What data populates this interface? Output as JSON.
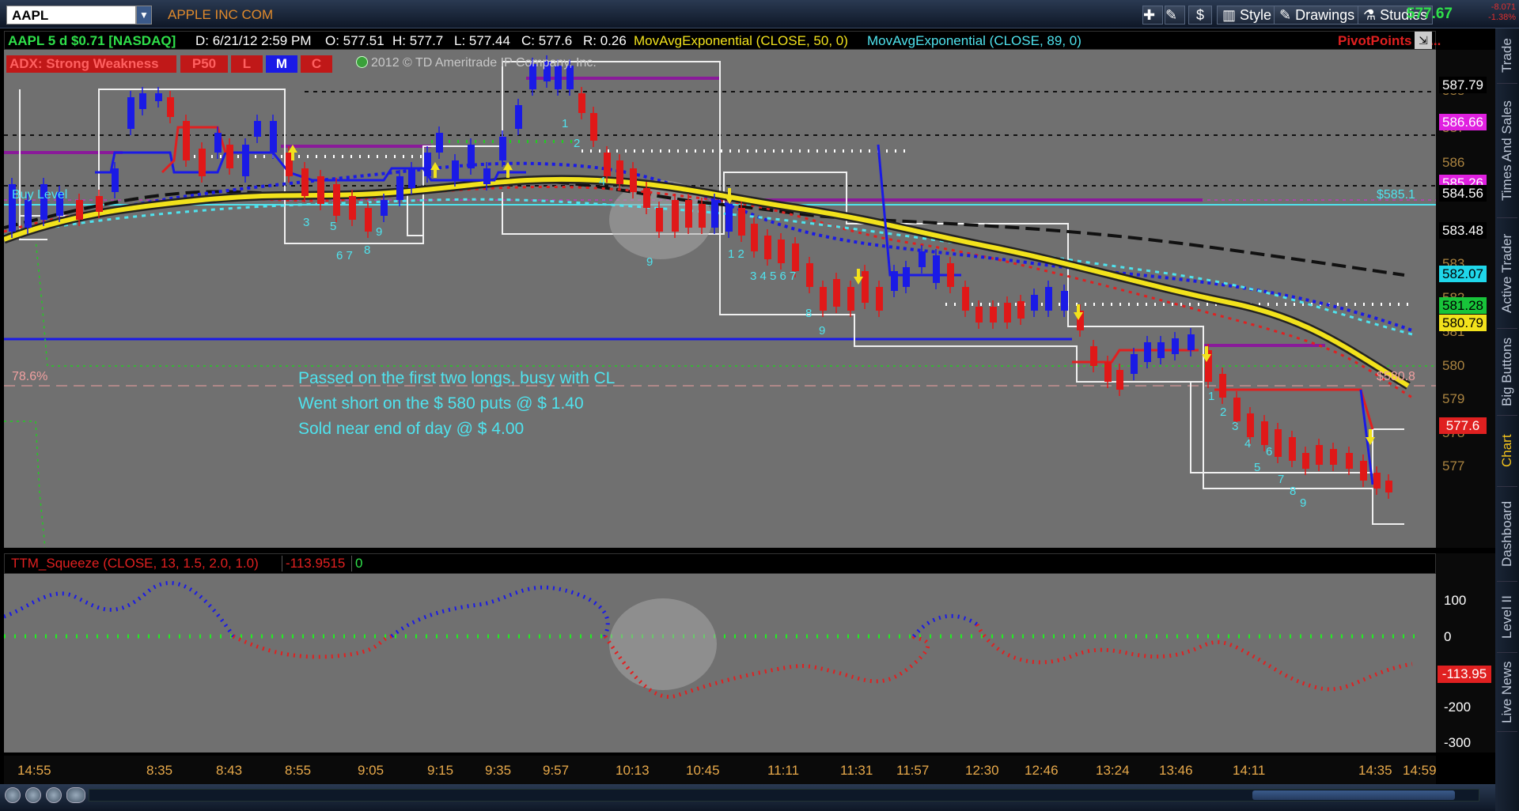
{
  "toolbar": {
    "symbol": "AAPL",
    "company": "APPLE INC COM",
    "dollar_label": "$",
    "style_label": "Style",
    "drawings_label": "Drawings",
    "studies_label": "Studies",
    "last_price": "577.67",
    "change_abs": "-8.071",
    "change_pct": "-1.38%"
  },
  "info": {
    "symbol_desc": "AAPL 5 d $0.71 [NASDAQ]",
    "date": "D: 6/21/12 2:59 PM",
    "open": "O: 577.51",
    "high": "H: 577.7",
    "low": "L: 577.44",
    "close": "C: 577.6",
    "range": "R: 0.26",
    "ema50": "MovAvgExponential (CLOSE, 50, 0)",
    "ema89": "MovAvgExponential (CLOSE, 89, 0)",
    "pivot": "PivotPoints (N..."
  },
  "indicators": {
    "adx": "ADX: Strong Weakness",
    "p50": "P50",
    "l": "L",
    "m": "M",
    "c": "C",
    "copyright": "2012 © TD Ameritrade IP Company, Inc."
  },
  "right_tabs": [
    "Trade",
    "Times And Sales",
    "Active Trader",
    "Big Buttons",
    "Chart",
    "Dashboard",
    "Level II",
    "Live News"
  ],
  "price_labels": [
    {
      "text": "587.79",
      "bg": "#000000",
      "fg": "#ffffff"
    },
    {
      "text": "586.66",
      "bg": "#e020e0",
      "fg": "#ffffff"
    },
    {
      "text": "585.26",
      "bg": "#e020e0",
      "fg": "#ffffff"
    },
    {
      "text": "584.56",
      "bg": "#000000",
      "fg": "#ffffff"
    },
    {
      "text": "583.48",
      "bg": "#000000",
      "fg": "#ffffff"
    },
    {
      "text": "582.07",
      "bg": "#1fd7ea",
      "fg": "#000000"
    },
    {
      "text": "581.28",
      "bg": "#18c43a",
      "fg": "#000000"
    },
    {
      "text": "580.79",
      "bg": "#f2e21c",
      "fg": "#000000"
    },
    {
      "text": "577.6",
      "bg": "#e02020",
      "fg": "#ffffff"
    }
  ],
  "axis_ticks": [
    "588",
    "587",
    "586",
    "585",
    "584",
    "583",
    "582",
    "581",
    "580",
    "579",
    "578",
    "577"
  ],
  "chart_labels": {
    "buy_level": "Buy Level",
    "level_585": "$585.1",
    "level_580": "$580.8",
    "fib": "78.6%"
  },
  "notes": [
    "Passed on the first two longs, busy with CL",
    "Went short on the $ 580 puts @ $ 1.40",
    "Sold near end of day @ $ 4.00"
  ],
  "lower": {
    "study": "TTM_Squeeze (CLOSE, 13, 1.5, 2.0, 1.0)",
    "value": "-113.9515",
    "zero": "0",
    "ticks": [
      "100",
      "0",
      "-200",
      "-300"
    ],
    "current": "-113.95"
  },
  "time_axis": [
    "14:55",
    "8:35",
    "8:43",
    "8:55",
    "9:05",
    "9:15",
    "9:35",
    "9:57",
    "10:13",
    "10:45",
    "11:11",
    "11:31",
    "11:57",
    "12:30",
    "12:46",
    "13:24",
    "13:46",
    "14:11",
    "14:35",
    "14:59"
  ],
  "colors": {
    "up": "#1a1ae6",
    "down": "#e01818",
    "ema50": "#f2e21c",
    "ema89": "#4fe3ee",
    "background": "#707070"
  }
}
